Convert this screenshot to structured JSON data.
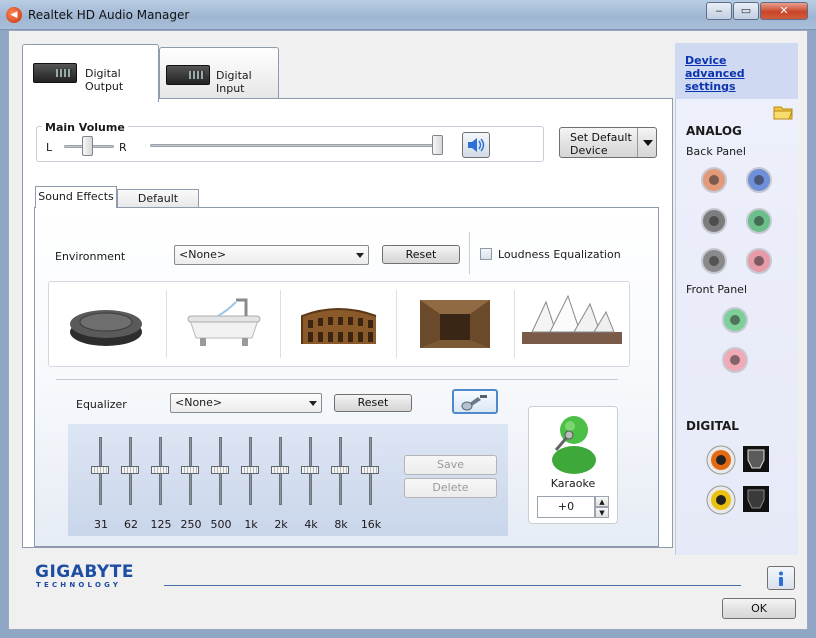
{
  "window": {
    "title": "Realtek HD Audio Manager",
    "controls": {
      "minimize": "‒",
      "maximize": "▭",
      "close": "✕"
    }
  },
  "main_tabs": [
    {
      "label": "Digital Output",
      "active": true
    },
    {
      "label": "Digital Input",
      "active": false
    }
  ],
  "volume": {
    "group_label": "Main Volume",
    "left_label": "L",
    "right_label": "R",
    "balance_level": 0.5,
    "volume_level": 1.0
  },
  "set_default_device": {
    "label": "Set Default Device"
  },
  "sub_tabs": [
    {
      "label": "Sound Effects",
      "active": true
    },
    {
      "label": "Default Format",
      "active": false
    }
  ],
  "environment": {
    "label": "Environment",
    "selected": "<None>",
    "reset_label": "Reset",
    "loudness_label": "Loudness Equalization",
    "loudness_checked": false,
    "presets_icons": [
      "stone-disc-icon",
      "bathtub-icon",
      "colosseum-icon",
      "stone-corridor-icon",
      "opera-house-icon"
    ]
  },
  "equalizer": {
    "label": "Equalizer",
    "selected": "<None>",
    "reset_label": "Reset",
    "bands": [
      "31",
      "62",
      "125",
      "250",
      "500",
      "1k",
      "2k",
      "4k",
      "8k",
      "16k"
    ],
    "save_label": "Save",
    "delete_label": "Delete"
  },
  "karaoke": {
    "label": "Karaoke",
    "value": "+0"
  },
  "right_panel": {
    "device_advanced_settings": "Device advanced settings",
    "analog_label": "ANALOG",
    "back_panel_label": "Back Panel",
    "front_panel_label": "Front Panel",
    "digital_label": "DIGITAL",
    "back_jacks": [
      "#e39a7a",
      "#6f8fd8",
      "#7d7d7d",
      "#6bbf8a",
      "#8a8a8a",
      "#e79aa8"
    ],
    "front_jacks": [
      "#7fcf9a",
      "#f0aab6"
    ]
  },
  "footer": {
    "brand": "GIGABYTE",
    "brand_sub": "TECHNOLOGY",
    "ok_label": "OK"
  },
  "colors": {
    "link": "#0b34b0",
    "brand": "#1d4ea3"
  }
}
